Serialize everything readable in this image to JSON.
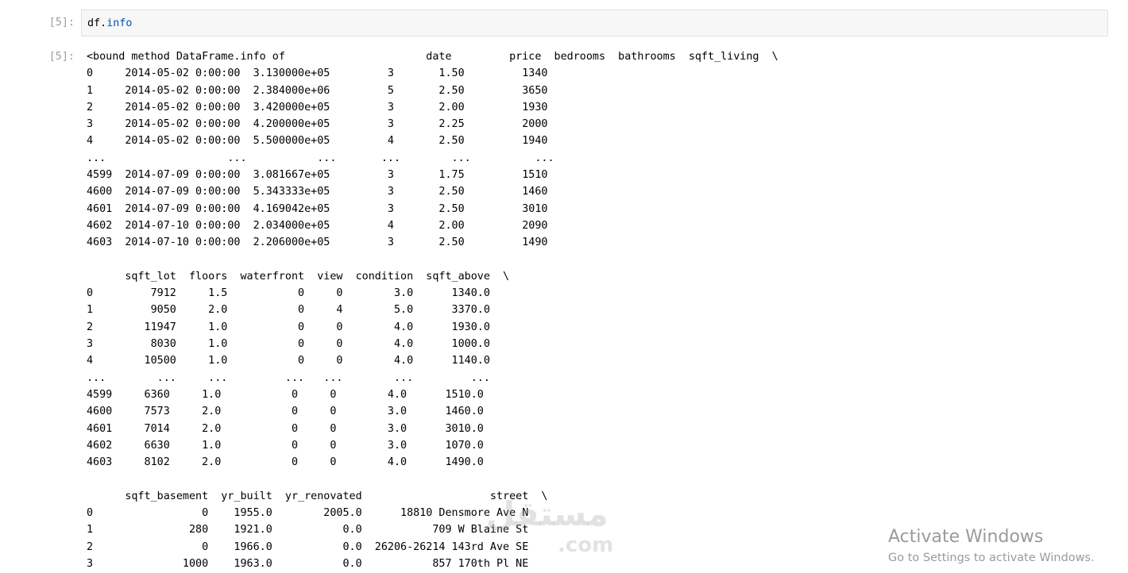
{
  "notebook": {
    "input_cell": {
      "prompt": "[5]:",
      "code_var": "df",
      "code_dot": ".",
      "code_attr": "info"
    },
    "output_cell": {
      "prompt": "[5]:",
      "lines": [
        "<bound method DataFrame.info of                      date         price  bedrooms  bathrooms  sqft_living  \\",
        "0     2014-05-02 0:00:00  3.130000e+05         3       1.50         1340",
        "1     2014-05-02 0:00:00  2.384000e+06         5       2.50         3650",
        "2     2014-05-02 0:00:00  3.420000e+05         3       2.00         1930",
        "3     2014-05-02 0:00:00  4.200000e+05         3       2.25         2000",
        "4     2014-05-02 0:00:00  5.500000e+05         4       2.50         1940",
        "...                   ...           ...       ...        ...          ...",
        "4599  2014-07-09 0:00:00  3.081667e+05         3       1.75         1510",
        "4600  2014-07-09 0:00:00  5.343333e+05         3       2.50         1460",
        "4601  2014-07-09 0:00:00  4.169042e+05         3       2.50         3010",
        "4602  2014-07-10 0:00:00  2.034000e+05         4       2.00         2090",
        "4603  2014-07-10 0:00:00  2.206000e+05         3       2.50         1490",
        "",
        "      sqft_lot  floors  waterfront  view  condition  sqft_above  \\",
        "0         7912     1.5           0     0        3.0      1340.0",
        "1         9050     2.0           0     4        5.0      3370.0",
        "2        11947     1.0           0     0        4.0      1930.0",
        "3         8030     1.0           0     0        4.0      1000.0",
        "4        10500     1.0           0     0        4.0      1140.0",
        "...        ...     ...         ...   ...        ...         ...",
        "4599     6360     1.0           0     0        4.0      1510.0",
        "4600     7573     2.0           0     0        3.0      1460.0",
        "4601     7014     2.0           0     0        3.0      3010.0",
        "4602     6630     1.0           0     0        3.0      1070.0",
        "4603     8102     2.0           0     0        4.0      1490.0",
        "",
        "      sqft_basement  yr_built  yr_renovated                    street  \\",
        "0                 0    1955.0        2005.0      18810 Densmore Ave N",
        "1               280    1921.0           0.0           709 W Blaine St",
        "2                 0    1966.0           0.0  26206-26214 143rd Ave SE",
        "3              1000    1963.0           0.0           857 170th Pl NE"
      ]
    }
  },
  "watermark": {
    "arabic": "مستقل",
    "latin": "mostaql.com"
  },
  "activation_notice": {
    "title": "Activate Windows",
    "subtitle": "Go to Settings to activate Windows."
  }
}
